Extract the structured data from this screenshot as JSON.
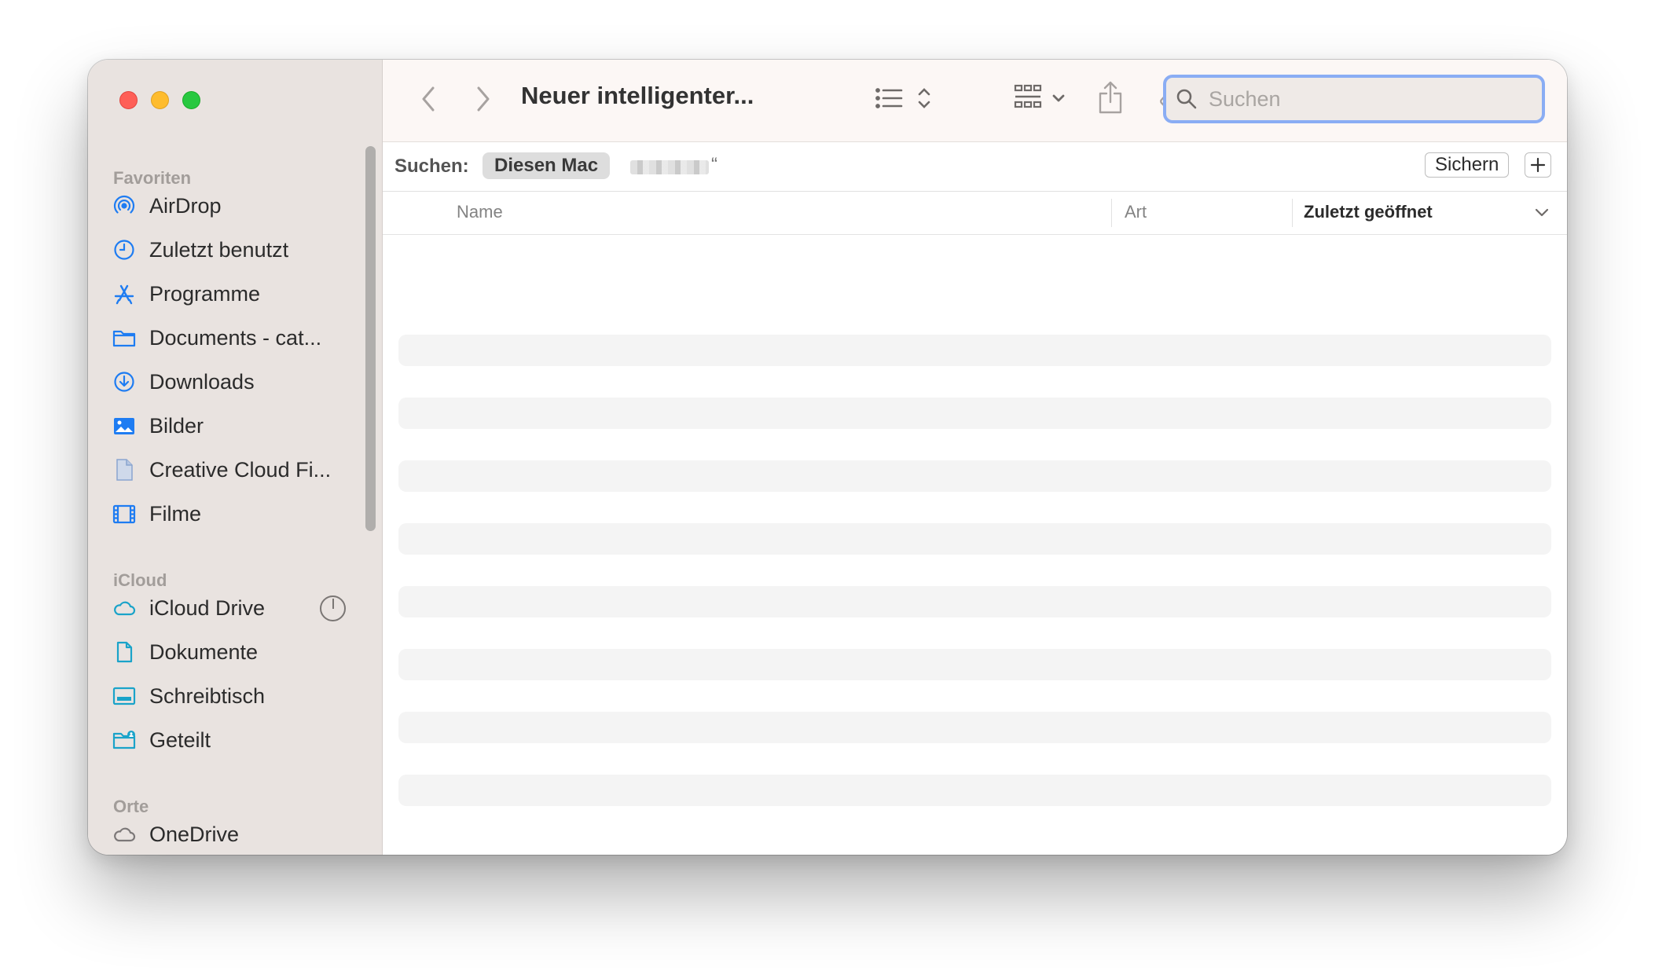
{
  "window": {
    "title": "Neuer intelligenter...",
    "traffic_lights": {
      "close": "#fe5f57",
      "minimize": "#febc2e",
      "zoom": "#28c840"
    }
  },
  "sidebar": {
    "sections": [
      {
        "heading": "Favoriten",
        "items": [
          {
            "label": "AirDrop",
            "icon": "airdrop-icon"
          },
          {
            "label": "Zuletzt benutzt",
            "icon": "clock-icon"
          },
          {
            "label": "Programme",
            "icon": "app-store-icon"
          },
          {
            "label": "Documents - cat...",
            "icon": "folder-icon"
          },
          {
            "label": "Downloads",
            "icon": "download-icon"
          },
          {
            "label": "Bilder",
            "icon": "photo-icon"
          },
          {
            "label": "Creative Cloud Fi...",
            "icon": "document-icon"
          },
          {
            "label": "Filme",
            "icon": "film-icon"
          }
        ]
      },
      {
        "heading": "iCloud",
        "items": [
          {
            "label": "iCloud Drive",
            "icon": "cloud-icon"
          },
          {
            "label": "Dokumente",
            "icon": "document-icon"
          },
          {
            "label": "Schreibtisch",
            "icon": "desktop-icon"
          },
          {
            "label": "Geteilt",
            "icon": "shared-folder-icon"
          }
        ]
      },
      {
        "heading": "Orte",
        "items": [
          {
            "label": "OneDrive",
            "icon": "cloud-icon"
          }
        ]
      }
    ]
  },
  "toolbar": {
    "search_placeholder": "Suchen",
    "icons": [
      "back-icon",
      "forward-icon",
      "list-view-icon",
      "group-icon",
      "share-icon",
      "tag-icon",
      "more-icon",
      "search-icon"
    ]
  },
  "search_bar": {
    "prefix": "Suchen:",
    "scope_selected": "Diesen Mac",
    "scope_other_suffix": "“",
    "save_label": "Sichern",
    "add_label": "+"
  },
  "columns": {
    "name": "Name",
    "kind": "Art",
    "last_opened": "Zuletzt geöffnet"
  },
  "accent_color": "#1e7cf2"
}
